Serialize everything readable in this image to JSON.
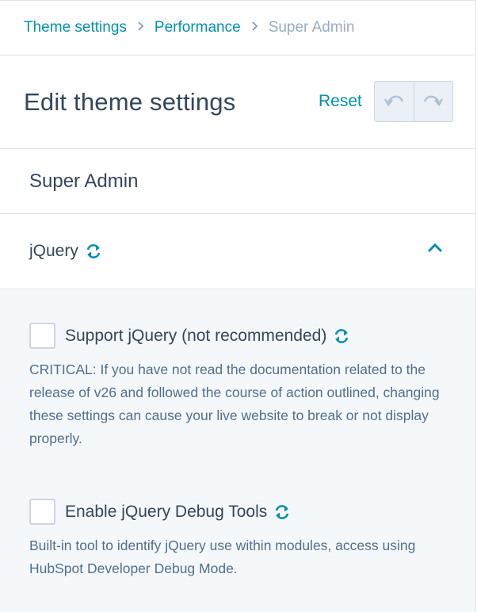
{
  "breadcrumb": {
    "items": [
      "Theme settings",
      "Performance"
    ],
    "current": "Super Admin"
  },
  "header": {
    "title": "Edit theme settings",
    "reset_label": "Reset"
  },
  "section": {
    "title": "Super Admin"
  },
  "accordion": {
    "label": "jQuery",
    "expanded": true
  },
  "options": [
    {
      "label": "Support jQuery (not recommended)",
      "checked": false,
      "description": "CRITICAL: If you have not read the documentation related to the release of v26 and followed the course of action outlined, changing these settings can cause your live website to break or not display properly."
    },
    {
      "label": "Enable jQuery Debug Tools",
      "checked": false,
      "description": "Built-in tool to identify jQuery use within modules, access using HubSpot Developer Debug Mode."
    }
  ],
  "colors": {
    "accent": "#0091ae",
    "text": "#33475b",
    "muted": "#99acc2",
    "panel_bg": "#f5f8fa"
  },
  "icons": {
    "breadcrumb_separator": "chevron-right-icon",
    "undo": "undo-icon",
    "redo": "redo-icon",
    "sync": "sync-icon",
    "collapse": "chevron-up-icon"
  }
}
